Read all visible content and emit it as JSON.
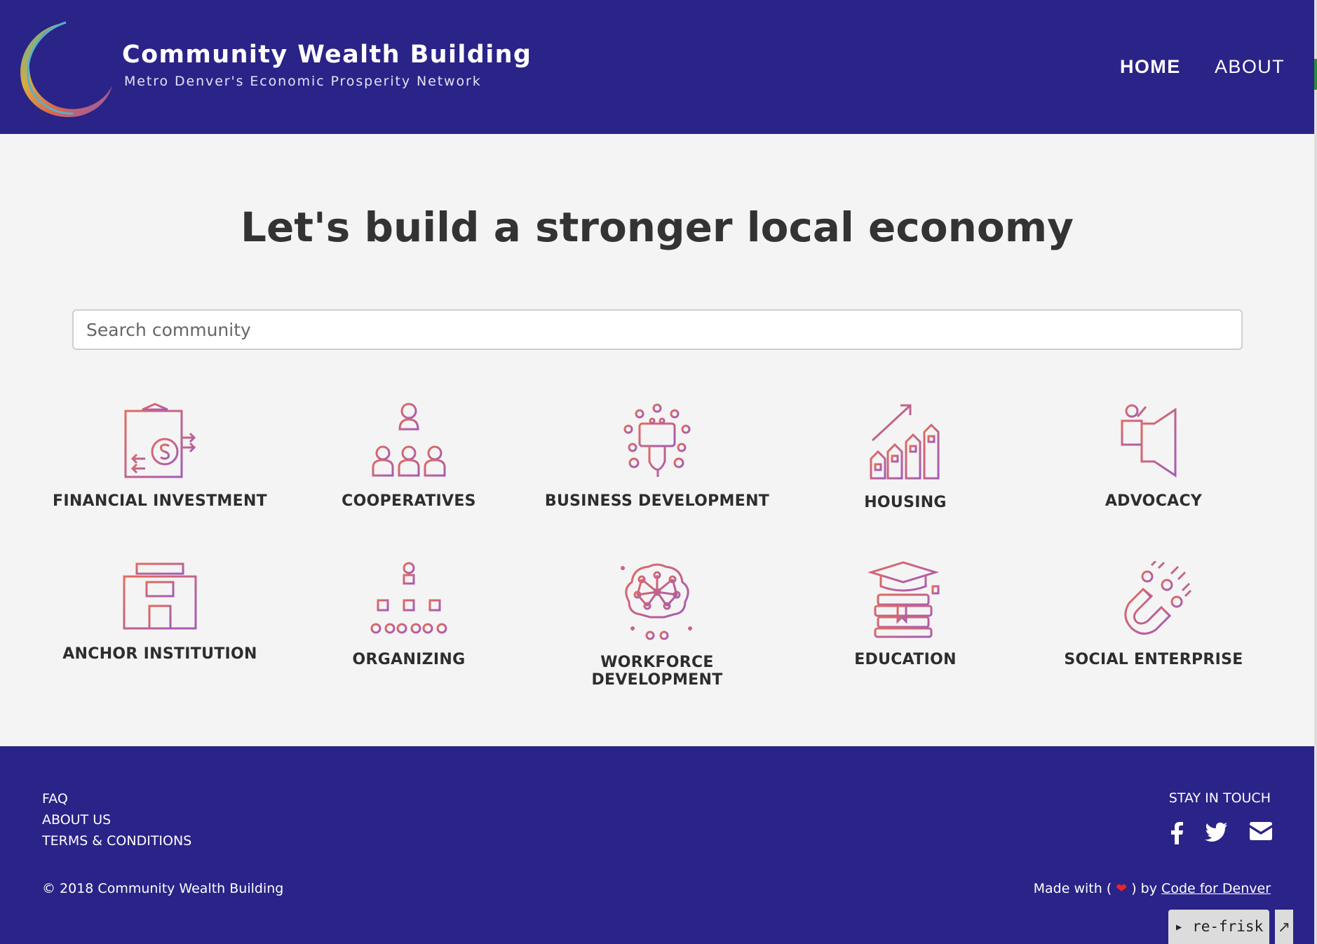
{
  "header": {
    "brand_title": "Community Wealth Building",
    "brand_subtitle": "Metro Denver's Economic Prosperity Network",
    "nav": [
      {
        "label": "HOME",
        "active": true
      },
      {
        "label": "ABOUT",
        "active": false
      }
    ]
  },
  "hero": {
    "title": "Let's build a stronger local economy",
    "search_placeholder": "Search community"
  },
  "categories": [
    {
      "label": "FINANCIAL INVESTMENT",
      "icon": "bank-dollar-exchange-icon"
    },
    {
      "label": "COOPERATIVES",
      "icon": "org-chart-people-icon"
    },
    {
      "label": "BUSINESS DEVELOPMENT",
      "icon": "hand-card-idea-icon"
    },
    {
      "label": "HOUSING",
      "icon": "houses-growth-icon"
    },
    {
      "label": "ADVOCACY",
      "icon": "megaphone-person-icon"
    },
    {
      "label": "ANCHOR INSTITUTION",
      "icon": "building-icon"
    },
    {
      "label": "ORGANIZING",
      "icon": "network-hierarchy-icon"
    },
    {
      "label": "WORKFORCE DEVELOPMENT",
      "icon": "brain-network-icon"
    },
    {
      "label": "EDUCATION",
      "icon": "graduation-books-icon"
    },
    {
      "label": "SOCIAL ENTERPRISE",
      "icon": "magnet-icon"
    }
  ],
  "footer": {
    "links": [
      "FAQ",
      "ABOUT US",
      "TERMS & CONDITIONS"
    ],
    "stay_in_touch": "STAY IN TOUCH",
    "social": [
      "facebook-icon",
      "twitter-icon",
      "envelope-icon"
    ],
    "copyright": "© 2018 Community Wealth Building",
    "made_prefix": "Made with (",
    "made_mid": ") by",
    "made_link": "Code for Denver"
  },
  "devtools": {
    "refrisk_label": "▸ re-frisk",
    "expand_glyph": "↗"
  },
  "colors": {
    "brand": "#2a2388",
    "background": "#f4f4f4",
    "icon_gradient_start": "#e36b5b",
    "icon_gradient_end": "#a35bb8"
  }
}
